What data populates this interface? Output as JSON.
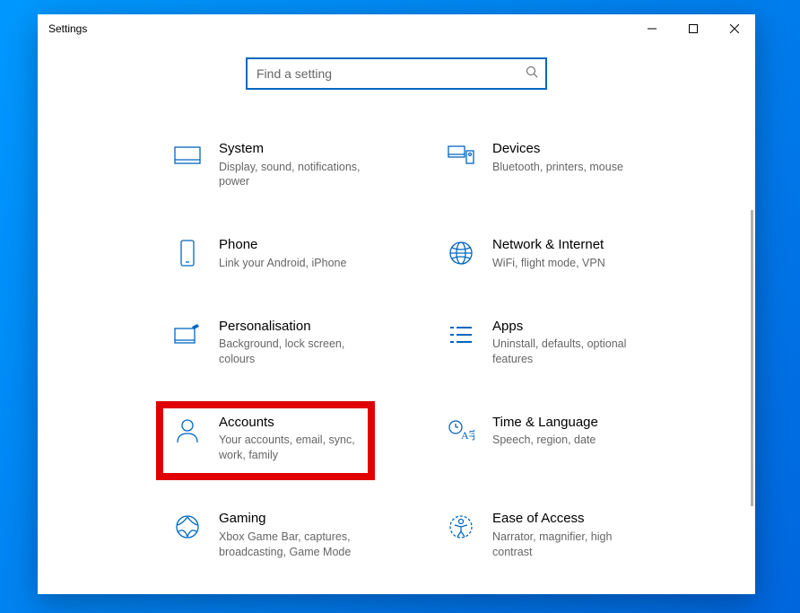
{
  "window": {
    "title": "Settings"
  },
  "search": {
    "placeholder": "Find a setting"
  },
  "categories": [
    {
      "key": "system",
      "title": "System",
      "desc": "Display, sound, notifications, power"
    },
    {
      "key": "devices",
      "title": "Devices",
      "desc": "Bluetooth, printers, mouse"
    },
    {
      "key": "phone",
      "title": "Phone",
      "desc": "Link your Android, iPhone"
    },
    {
      "key": "network",
      "title": "Network & Internet",
      "desc": "WiFi, flight mode, VPN"
    },
    {
      "key": "personal",
      "title": "Personalisation",
      "desc": "Background, lock screen, colours"
    },
    {
      "key": "apps",
      "title": "Apps",
      "desc": "Uninstall, defaults, optional features"
    },
    {
      "key": "accounts",
      "title": "Accounts",
      "desc": "Your accounts, email, sync, work, family"
    },
    {
      "key": "time",
      "title": "Time & Language",
      "desc": "Speech, region, date"
    },
    {
      "key": "gaming",
      "title": "Gaming",
      "desc": "Xbox Game Bar, captures, broadcasting, Game Mode"
    },
    {
      "key": "ease",
      "title": "Ease of Access",
      "desc": "Narrator, magnifier, high contrast"
    }
  ],
  "highlighted": "accounts"
}
